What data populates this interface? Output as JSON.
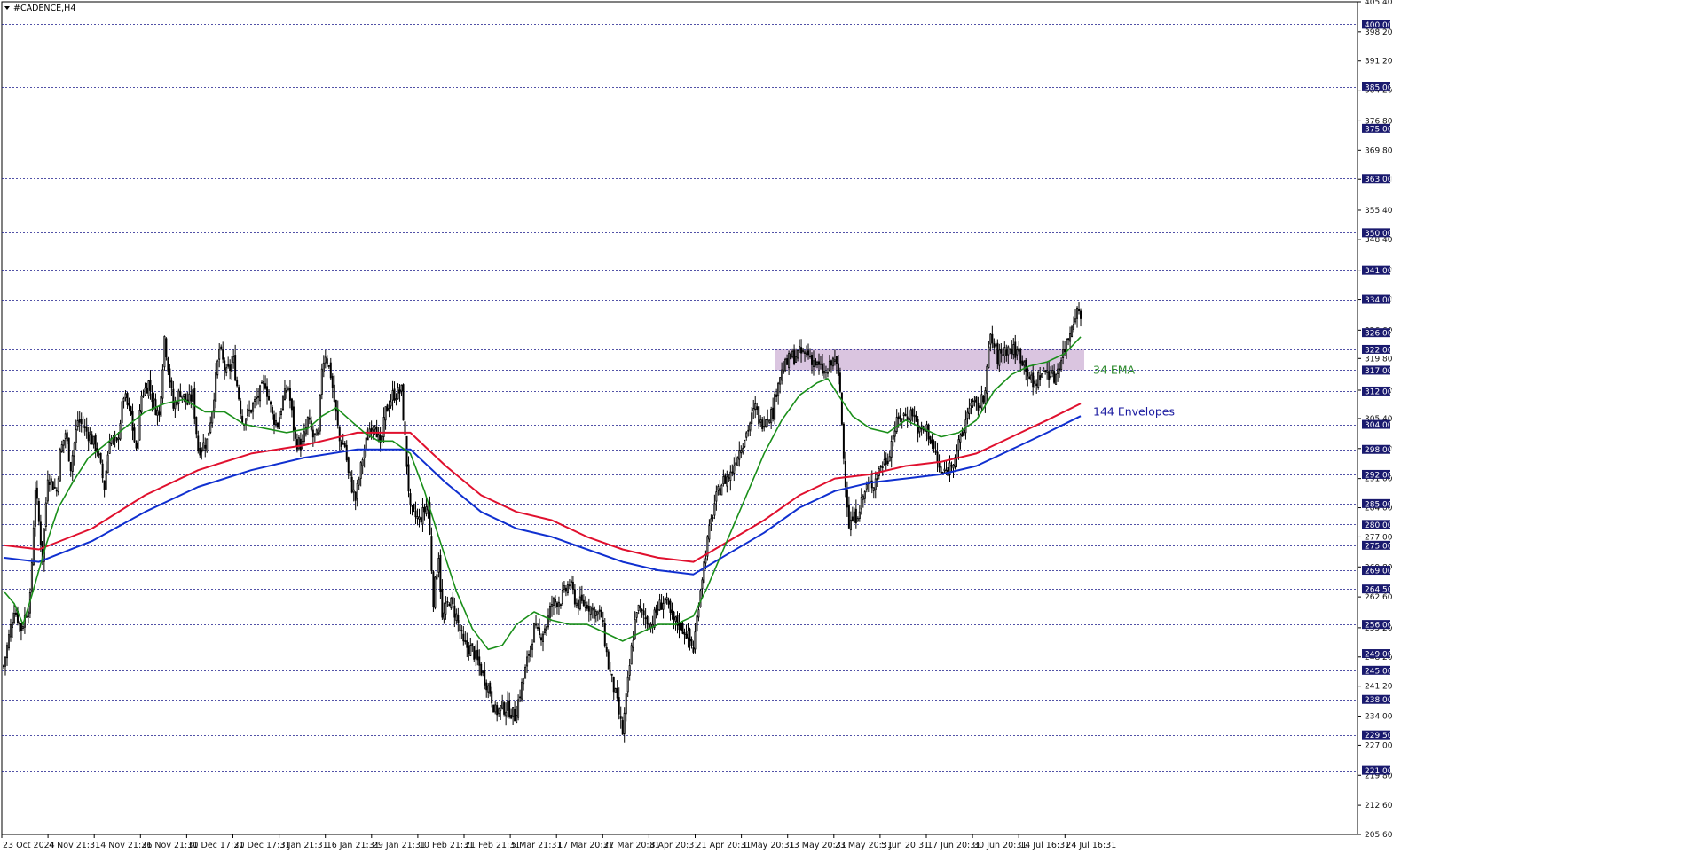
{
  "window": {
    "symbol_title": "#CADENCE,H4"
  },
  "chart_data": {
    "type": "candlestick",
    "title": "#CADENCE,H4",
    "ylim": [
      205.6,
      405.4
    ],
    "y_ticks": [
      "405.40",
      "398.20",
      "391.20",
      "384.20",
      "376.80",
      "369.80",
      "362.80",
      "355.40",
      "348.40",
      "341.00",
      "334.00",
      "326.60",
      "319.80",
      "312.20",
      "305.40",
      "298.20",
      "291.00",
      "284.00",
      "277.00",
      "269.80",
      "262.60",
      "255.20",
      "248.20",
      "241.20",
      "234.00",
      "227.00",
      "219.80",
      "212.60",
      "205.60"
    ],
    "levels": [
      "400.00",
      "385.00",
      "375.00",
      "363.00",
      "350.00",
      "341.00",
      "334.00",
      "326.00",
      "322.00",
      "317.00",
      "312.00",
      "304.00",
      "298.00",
      "292.00",
      "285.00",
      "280.00",
      "275.00",
      "269.00",
      "264.50",
      "256.00",
      "249.00",
      "245.00",
      "238.00",
      "229.50",
      "221.00"
    ],
    "x_labels": [
      "23 Oct 2024",
      "4 Nov 21:31",
      "14 Nov 21:31",
      "26 Nov 21:31",
      "10 Dec 17:31",
      "20 Dec 17:31",
      "3 Jan 21:31",
      "16 Jan 21:31",
      "29 Jan 21:31",
      "10 Feb 21:31",
      "21 Feb 21:31",
      "5 Mar 21:31",
      "17 Mar 20:31",
      "27 Mar 20:31",
      "8 Apr 20:31",
      "21 Apr 20:31",
      "1 May 20:31",
      "13 May 20:31",
      "23 May 20:31",
      "5 Jun 20:31",
      "17 Jun 20:31",
      "30 Jun 20:31",
      "14 Jul 16:31",
      "24 Jul 16:31"
    ],
    "close_path": [
      [
        0,
        246
      ],
      [
        6,
        260
      ],
      [
        10,
        255
      ],
      [
        15,
        262
      ],
      [
        18,
        289
      ],
      [
        22,
        272
      ],
      [
        25,
        292
      ],
      [
        30,
        288
      ],
      [
        32,
        297
      ],
      [
        35,
        302
      ],
      [
        38,
        294
      ],
      [
        42,
        305
      ],
      [
        46,
        303
      ],
      [
        49,
        301
      ],
      [
        53,
        298
      ],
      [
        57,
        289
      ],
      [
        60,
        301
      ],
      [
        64,
        299
      ],
      [
        68,
        311
      ],
      [
        72,
        306
      ],
      [
        75,
        297
      ],
      [
        78,
        311
      ],
      [
        82,
        314
      ],
      [
        85,
        309
      ],
      [
        88,
        306
      ],
      [
        91,
        325
      ],
      [
        96,
        308
      ],
      [
        100,
        312
      ],
      [
        104,
        309
      ],
      [
        107,
        311
      ],
      [
        110,
        298
      ],
      [
        115,
        300
      ],
      [
        118,
        308
      ],
      [
        122,
        322
      ],
      [
        126,
        316
      ],
      [
        130,
        319
      ],
      [
        135,
        305
      ],
      [
        139,
        307
      ],
      [
        143,
        310
      ],
      [
        148,
        314
      ],
      [
        152,
        306
      ],
      [
        155,
        304
      ],
      [
        158,
        310
      ],
      [
        161,
        313
      ],
      [
        165,
        300
      ],
      [
        169,
        299
      ],
      [
        172,
        305
      ],
      [
        175,
        301
      ],
      [
        178,
        301
      ],
      [
        180,
        318
      ],
      [
        182,
        321
      ],
      [
        185,
        316
      ],
      [
        190,
        300
      ],
      [
        193,
        299
      ],
      [
        195,
        292
      ],
      [
        199,
        286
      ],
      [
        203,
        296
      ],
      [
        207,
        303
      ],
      [
        210,
        305
      ],
      [
        213,
        298
      ],
      [
        216,
        307
      ],
      [
        220,
        311
      ],
      [
        225,
        312
      ],
      [
        230,
        283
      ],
      [
        235,
        281
      ],
      [
        240,
        285
      ],
      [
        243,
        262
      ],
      [
        246,
        273
      ],
      [
        248,
        257
      ],
      [
        252,
        262
      ],
      [
        256,
        258
      ],
      [
        260,
        251
      ],
      [
        265,
        250
      ],
      [
        270,
        245
      ],
      [
        275,
        240
      ],
      [
        278,
        235
      ],
      [
        282,
        236
      ],
      [
        285,
        236
      ],
      [
        289,
        234
      ],
      [
        295,
        245
      ],
      [
        300,
        255
      ],
      [
        303,
        253
      ],
      [
        307,
        256
      ],
      [
        310,
        261
      ],
      [
        315,
        262
      ],
      [
        320,
        266
      ],
      [
        324,
        261
      ],
      [
        330,
        261
      ],
      [
        334,
        259
      ],
      [
        338,
        258
      ],
      [
        342,
        246
      ],
      [
        346,
        239
      ],
      [
        350,
        230
      ],
      [
        355,
        250
      ],
      [
        358,
        260
      ],
      [
        362,
        258
      ],
      [
        366,
        256
      ],
      [
        370,
        260
      ],
      [
        374,
        262
      ],
      [
        378,
        257
      ],
      [
        382,
        256
      ],
      [
        386,
        254
      ],
      [
        390,
        250
      ],
      [
        394,
        265
      ],
      [
        398,
        276
      ],
      [
        402,
        285
      ],
      [
        406,
        290
      ],
      [
        411,
        292
      ],
      [
        415,
        297
      ],
      [
        420,
        302
      ],
      [
        425,
        308
      ],
      [
        428,
        304
      ],
      [
        431,
        306
      ],
      [
        435,
        307
      ],
      [
        438,
        315
      ],
      [
        442,
        318
      ],
      [
        445,
        320
      ],
      [
        450,
        321
      ],
      [
        455,
        321
      ],
      [
        460,
        318
      ],
      [
        465,
        316
      ],
      [
        470,
        320
      ],
      [
        473,
        312
      ],
      [
        475,
        296
      ],
      [
        478,
        280
      ],
      [
        482,
        282
      ],
      [
        488,
        289
      ],
      [
        492,
        290
      ],
      [
        496,
        294
      ],
      [
        500,
        296
      ],
      [
        503,
        302
      ],
      [
        507,
        306
      ],
      [
        510,
        306
      ],
      [
        514,
        307
      ],
      [
        518,
        302
      ],
      [
        522,
        303
      ],
      [
        526,
        298
      ],
      [
        530,
        292
      ],
      [
        534,
        293
      ],
      [
        538,
        297
      ],
      [
        542,
        301
      ],
      [
        546,
        309
      ],
      [
        550,
        308
      ],
      [
        554,
        310
      ],
      [
        558,
        325
      ],
      [
        562,
        320
      ],
      [
        566,
        322
      ],
      [
        570,
        322
      ],
      [
        574,
        321
      ],
      [
        578,
        318
      ],
      [
        582,
        313
      ],
      [
        586,
        316
      ],
      [
        590,
        317
      ],
      [
        594,
        315
      ],
      [
        598,
        320
      ],
      [
        602,
        325
      ],
      [
        606,
        331
      ],
      [
        609,
        331
      ]
    ],
    "ema34": [
      [
        0,
        264
      ],
      [
        6,
        261
      ],
      [
        11,
        256
      ],
      [
        16,
        263
      ],
      [
        24,
        275
      ],
      [
        31,
        284
      ],
      [
        39,
        290
      ],
      [
        48,
        296
      ],
      [
        57,
        299
      ],
      [
        68,
        303
      ],
      [
        80,
        307
      ],
      [
        91,
        309
      ],
      [
        102,
        310
      ],
      [
        114,
        307
      ],
      [
        125,
        307
      ],
      [
        136,
        304
      ],
      [
        148,
        303
      ],
      [
        160,
        302
      ],
      [
        172,
        303
      ],
      [
        180,
        306
      ],
      [
        188,
        308
      ],
      [
        196,
        305
      ],
      [
        204,
        302
      ],
      [
        212,
        300
      ],
      [
        220,
        300
      ],
      [
        230,
        297
      ],
      [
        238,
        288
      ],
      [
        246,
        277
      ],
      [
        256,
        264
      ],
      [
        265,
        255
      ],
      [
        274,
        250
      ],
      [
        282,
        251
      ],
      [
        290,
        256
      ],
      [
        300,
        259
      ],
      [
        310,
        257
      ],
      [
        320,
        256
      ],
      [
        330,
        256
      ],
      [
        340,
        254
      ],
      [
        350,
        252
      ],
      [
        360,
        254
      ],
      [
        370,
        256
      ],
      [
        380,
        256
      ],
      [
        390,
        258
      ],
      [
        398,
        265
      ],
      [
        410,
        277
      ],
      [
        420,
        287
      ],
      [
        430,
        297
      ],
      [
        440,
        305
      ],
      [
        450,
        311
      ],
      [
        460,
        314
      ],
      [
        466,
        315
      ],
      [
        472,
        311
      ],
      [
        480,
        306
      ],
      [
        490,
        303
      ],
      [
        500,
        302
      ],
      [
        510,
        305
      ],
      [
        520,
        303
      ],
      [
        530,
        301
      ],
      [
        540,
        302
      ],
      [
        550,
        305
      ],
      [
        560,
        312
      ],
      [
        570,
        316
      ],
      [
        580,
        318
      ],
      [
        590,
        319
      ],
      [
        600,
        321
      ],
      [
        609,
        325
      ]
    ],
    "env_upper": [
      [
        0,
        275
      ],
      [
        20,
        274
      ],
      [
        50,
        279
      ],
      [
        80,
        287
      ],
      [
        110,
        293
      ],
      [
        140,
        297
      ],
      [
        170,
        299
      ],
      [
        200,
        302
      ],
      [
        230,
        302
      ],
      [
        250,
        294
      ],
      [
        270,
        287
      ],
      [
        290,
        283
      ],
      [
        310,
        281
      ],
      [
        330,
        277
      ],
      [
        350,
        274
      ],
      [
        370,
        272
      ],
      [
        390,
        271
      ],
      [
        410,
        276
      ],
      [
        430,
        281
      ],
      [
        450,
        287
      ],
      [
        470,
        291
      ],
      [
        490,
        292
      ],
      [
        510,
        294
      ],
      [
        530,
        295
      ],
      [
        550,
        297
      ],
      [
        570,
        301
      ],
      [
        590,
        305
      ],
      [
        609,
        309
      ]
    ],
    "env_lower": [
      [
        0,
        272
      ],
      [
        20,
        271
      ],
      [
        50,
        276
      ],
      [
        80,
        283
      ],
      [
        110,
        289
      ],
      [
        140,
        293
      ],
      [
        170,
        296
      ],
      [
        200,
        298
      ],
      [
        230,
        298
      ],
      [
        250,
        290
      ],
      [
        270,
        283
      ],
      [
        290,
        279
      ],
      [
        310,
        277
      ],
      [
        330,
        274
      ],
      [
        350,
        271
      ],
      [
        370,
        269
      ],
      [
        390,
        268
      ],
      [
        410,
        273
      ],
      [
        430,
        278
      ],
      [
        450,
        284
      ],
      [
        470,
        288
      ],
      [
        490,
        290
      ],
      [
        510,
        291
      ],
      [
        530,
        292
      ],
      [
        550,
        294
      ],
      [
        570,
        298
      ],
      [
        590,
        302
      ],
      [
        609,
        306
      ]
    ],
    "candle_x_range": [
      0,
      612
    ],
    "zone": {
      "from": 317.0,
      "to": 322.0,
      "x_from": 436,
      "x_to": 611
    },
    "annotations": [
      {
        "text": "34 EMA",
        "color": "#2e8b2e",
        "price": 317.0
      },
      {
        "text": "144 Envelopes",
        "color": "#1a1aa0",
        "price": 307.0
      }
    ],
    "colors": {
      "ema34": "#1a8f1a",
      "env_upper": "#e0102e",
      "env_lower": "#1030d0",
      "zone": "#d6bfdd",
      "levels": "#1a1a8a",
      "candles": "#000000"
    }
  }
}
